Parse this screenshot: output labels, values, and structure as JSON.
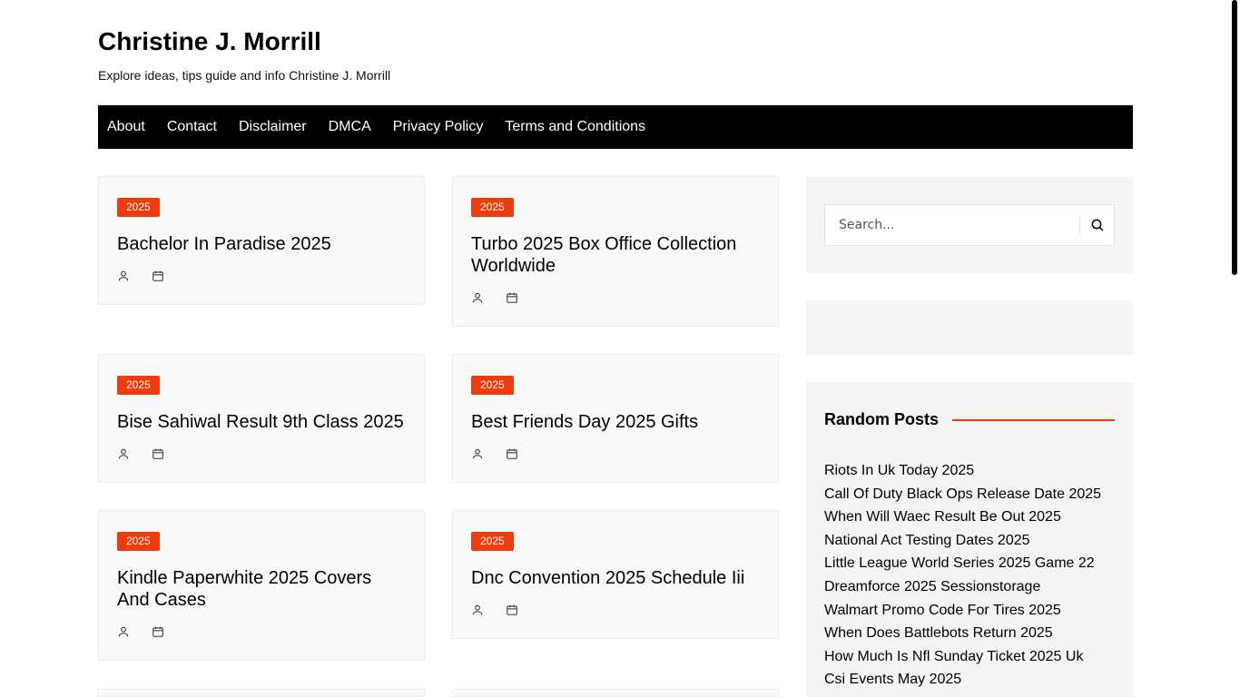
{
  "site": {
    "title": "Christine J. Morrill",
    "tagline": "Explore ideas, tips guide and info Christine J. Morrill"
  },
  "nav": {
    "items": [
      "About",
      "Contact",
      "Disclaimer",
      "DMCA",
      "Privacy Policy",
      "Terms and Conditions"
    ]
  },
  "posts": [
    {
      "category": "2025",
      "title": "Bachelor In Paradise 2025",
      "author_icon": "user-icon",
      "date_icon": "calendar-icon"
    },
    {
      "category": "2025",
      "title": "Turbo 2025 Box Office Collection Worldwide",
      "author_icon": "user-icon",
      "date_icon": "calendar-icon"
    },
    {
      "category": "2025",
      "title": "Bise Sahiwal Result 9th Class 2025",
      "author_icon": "user-icon",
      "date_icon": "calendar-icon"
    },
    {
      "category": "2025",
      "title": "Best Friends Day 2025 Gifts",
      "author_icon": "user-icon",
      "date_icon": "calendar-icon"
    },
    {
      "category": "2025",
      "title": "Kindle Paperwhite 2025 Covers And Cases",
      "author_icon": "user-icon",
      "date_icon": "calendar-icon"
    },
    {
      "category": "2025",
      "title": "Dnc Convention 2025 Schedule Iii",
      "author_icon": "user-icon",
      "date_icon": "calendar-icon"
    }
  ],
  "sidebar": {
    "search": {
      "placeholder": "Search...",
      "icon": "search-icon"
    },
    "random_posts": {
      "heading": "Random Posts",
      "items": [
        "Riots In Uk Today 2025",
        "Call Of Duty Black Ops Release Date 2025",
        "When Will Waec Result Be Out 2025",
        "National Act Testing Dates 2025",
        "Little League World Series 2025 Game 22",
        "Dreamforce 2025 Sessionstorage",
        "Walmart Promo Code For Tires 2025",
        "When Does Battlebots Return 2025",
        "How Much Is Nfl Sunday Ticket 2025 Uk",
        "Csi Events May 2025"
      ]
    }
  },
  "colors": {
    "accent": "#f03c0c",
    "nav_background": "#000000",
    "card_background": "#f9f9f9",
    "widget_background": "#f4f4f4"
  }
}
